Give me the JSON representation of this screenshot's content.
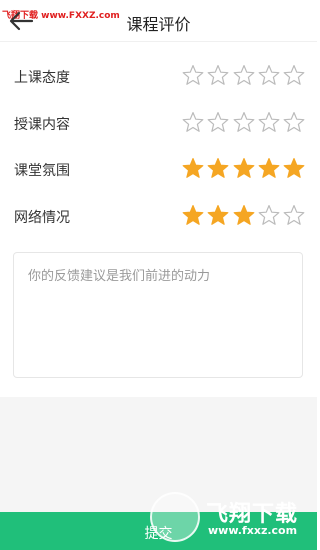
{
  "watermark": {
    "text": "飞翔下载 www.FXXZ.com"
  },
  "header": {
    "back_icon": "back-arrow-icon",
    "title": "课程评价"
  },
  "ratings": [
    {
      "label": "上课态度",
      "score": 0,
      "max": 5
    },
    {
      "label": "授课内容",
      "score": 0,
      "max": 5
    },
    {
      "label": "课堂氛围",
      "score": 5,
      "max": 5
    },
    {
      "label": "网络情况",
      "score": 3,
      "max": 5
    }
  ],
  "feedback": {
    "placeholder": "你的反馈建议是我们前进的动力",
    "value": ""
  },
  "submit": {
    "label": "提交"
  },
  "logo_watermark": {
    "text": "飞翔下载",
    "url": "www.fxxz.com"
  },
  "colors": {
    "star_filled": "#f5a623",
    "star_empty": "#bbbbbb",
    "submit_bg": "#20bf7a"
  }
}
